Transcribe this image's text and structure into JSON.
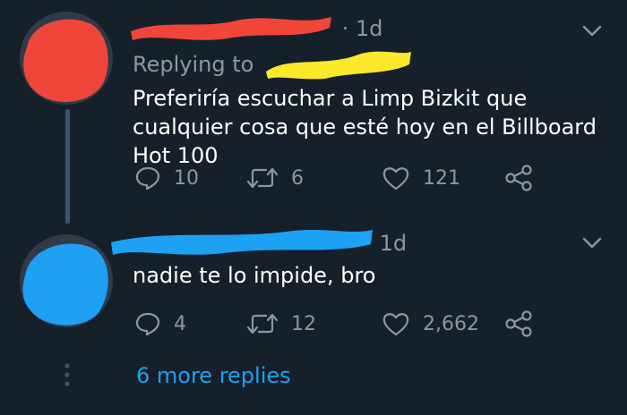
{
  "theme": {
    "background": "#15202b",
    "text_primary": "#ffffff",
    "text_secondary": "#8899a6",
    "link": "#1da1f2",
    "redaction_red": "#f0463a",
    "redaction_yellow": "#fbe82a",
    "redaction_blue": "#1ea1f2"
  },
  "tweets": [
    {
      "time": "· 1d",
      "replying_prefix": "Replying to",
      "text": "Preferiría escuchar a Limp Bizkit que cualquier cosa que esté hoy en el Billboard Hot 100",
      "actions": {
        "reply_count": "10",
        "retweet_count": "6",
        "like_count": "121"
      },
      "icons": [
        "reply-icon",
        "retweet-icon",
        "like-icon",
        "share-icon",
        "chevron-down-icon"
      ]
    },
    {
      "time": "1d",
      "text": "nadie te lo impide, bro",
      "actions": {
        "reply_count": "4",
        "retweet_count": "12",
        "like_count": "2,662"
      },
      "icons": [
        "reply-icon",
        "retweet-icon",
        "like-icon",
        "share-icon",
        "chevron-down-icon"
      ]
    }
  ],
  "thread": {
    "more_replies_label": "6 more replies"
  }
}
